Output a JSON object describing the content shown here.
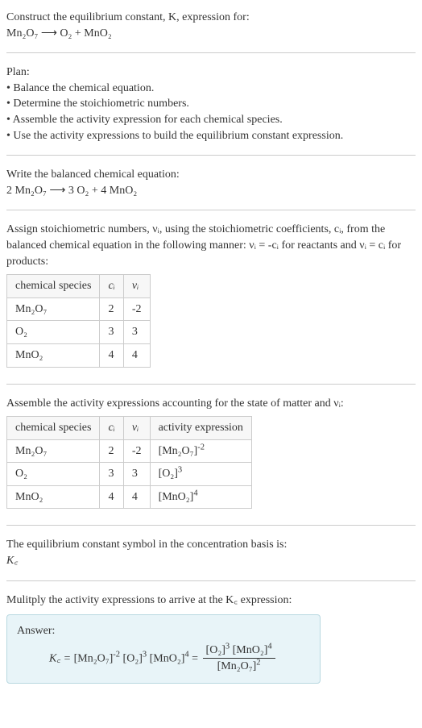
{
  "header": {
    "line1": "Construct the equilibrium constant, K, expression for:",
    "equation": "Mn₂O₇ ⟶ O₂ + MnO₂"
  },
  "plan": {
    "title": "Plan:",
    "items": [
      "• Balance the chemical equation.",
      "• Determine the stoichiometric numbers.",
      "• Assemble the activity expression for each chemical species.",
      "• Use the activity expressions to build the equilibrium constant expression."
    ]
  },
  "balanced": {
    "title": "Write the balanced chemical equation:",
    "equation": "2 Mn₂O₇ ⟶ 3 O₂ + 4 MnO₂"
  },
  "stoich": {
    "intro": "Assign stoichiometric numbers, νᵢ, using the stoichiometric coefficients, cᵢ, from the balanced chemical equation in the following manner: νᵢ = -cᵢ for reactants and νᵢ = cᵢ for products:",
    "headers": [
      "chemical species",
      "cᵢ",
      "νᵢ"
    ],
    "rows": [
      {
        "species": "Mn₂O₇",
        "c": "2",
        "v": "-2"
      },
      {
        "species": "O₂",
        "c": "3",
        "v": "3"
      },
      {
        "species": "MnO₂",
        "c": "4",
        "v": "4"
      }
    ]
  },
  "activity": {
    "intro": "Assemble the activity expressions accounting for the state of matter and νᵢ:",
    "headers": [
      "chemical species",
      "cᵢ",
      "νᵢ",
      "activity expression"
    ],
    "rows": [
      {
        "species": "Mn₂O₇",
        "c": "2",
        "v": "-2",
        "expr_base": "[Mn₂O₇]",
        "expr_pow": "-2"
      },
      {
        "species": "O₂",
        "c": "3",
        "v": "3",
        "expr_base": "[O₂]",
        "expr_pow": "3"
      },
      {
        "species": "MnO₂",
        "c": "4",
        "v": "4",
        "expr_base": "[MnO₂]",
        "expr_pow": "4"
      }
    ]
  },
  "symbol": {
    "line": "The equilibrium constant symbol in the concentration basis is:",
    "sym": "K꜀"
  },
  "multiply": {
    "line": "Mulitply the activity expressions to arrive at the K꜀ expression:"
  },
  "answer": {
    "label": "Answer:",
    "lhs": "K꜀ = ",
    "term1_base": "[Mn₂O₇]",
    "term1_pow": "-2",
    "term2_base": "[O₂]",
    "term2_pow": "3",
    "term3_base": "[MnO₂]",
    "term3_pow": "4",
    "eq": " = ",
    "num1_base": "[O₂]",
    "num1_pow": "3",
    "num2_base": "[MnO₂]",
    "num2_pow": "4",
    "den_base": "[Mn₂O₇]",
    "den_pow": "2"
  }
}
